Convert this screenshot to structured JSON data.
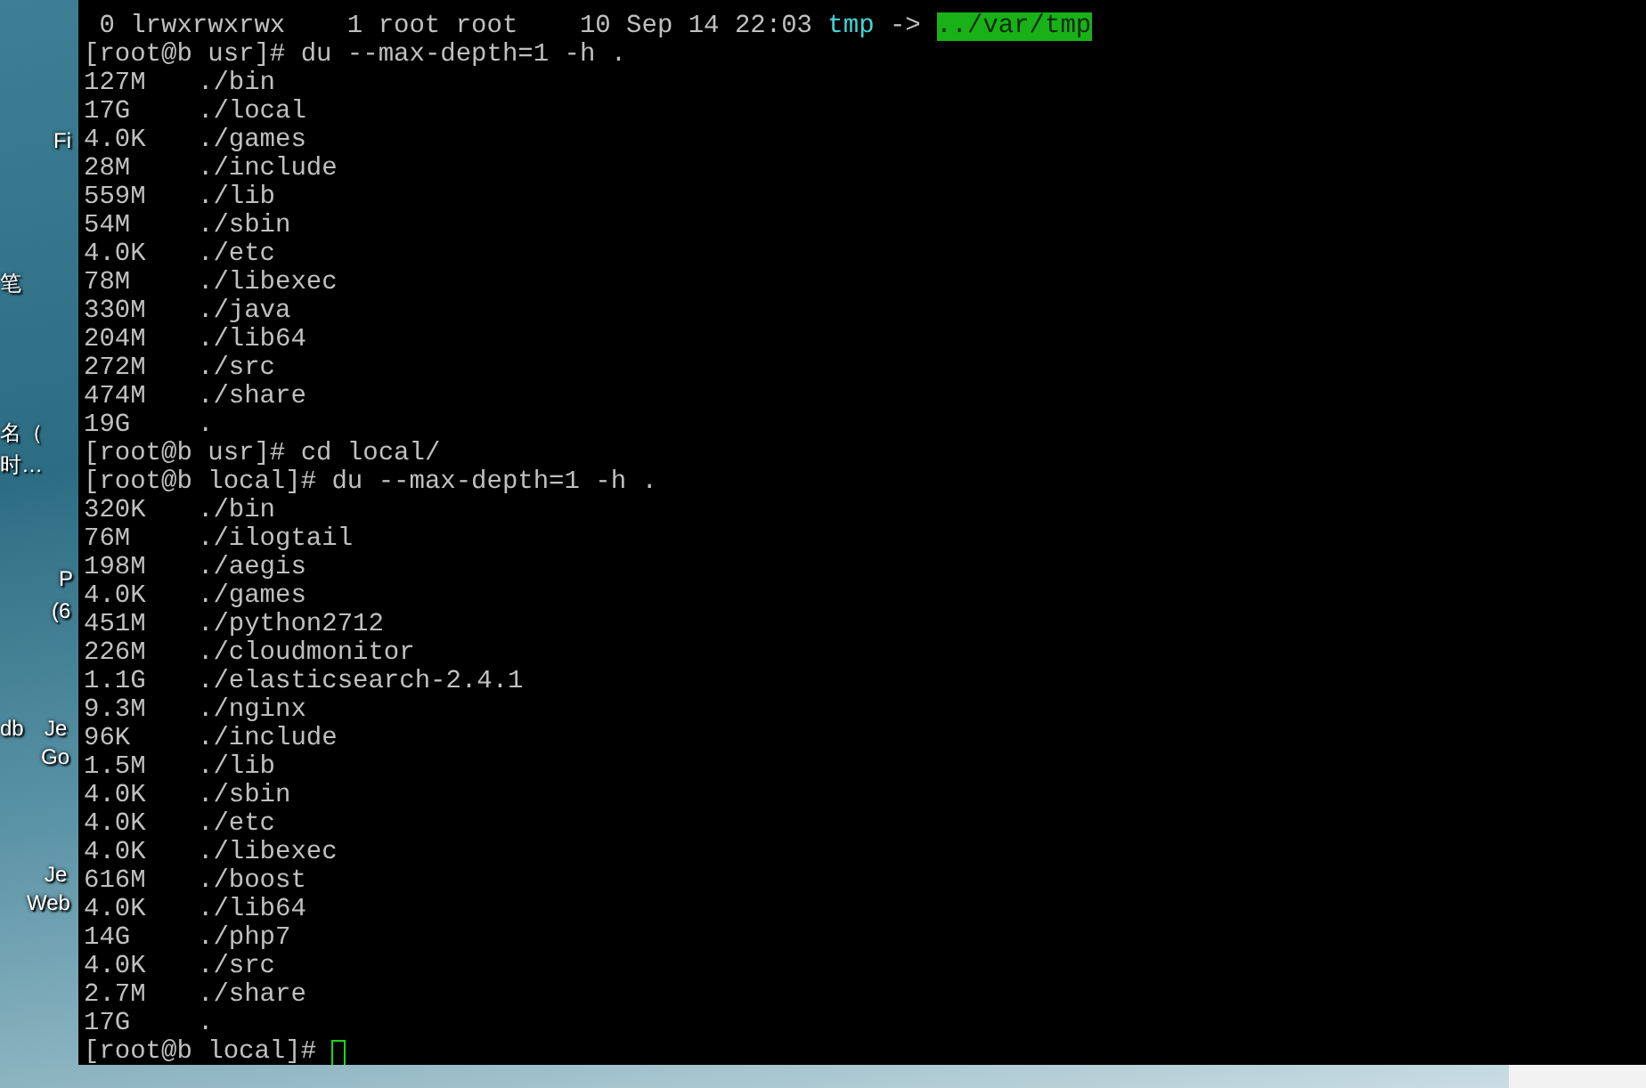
{
  "desktop": {
    "labels": [
      {
        "text": "Fi"
      },
      {
        "text": "笔"
      },
      {
        "text": "名（"
      },
      {
        "text": "时…"
      },
      {
        "text": "P"
      },
      {
        "text": "(6"
      },
      {
        "text": "db"
      },
      {
        "text": "Je"
      },
      {
        "text": "Go"
      },
      {
        "text": "Je"
      },
      {
        "text": "Web"
      }
    ]
  },
  "terminal": {
    "lines": [
      {
        "kind": "listing",
        "text": " 0 lrwxrwxrwx    1 root root    10 Sep 14 22:03 ",
        "name": "tmp",
        "color": "#3fd7d7",
        "arrow": " -> ",
        "target": "../var/tmp"
      },
      {
        "kind": "prompt",
        "prompt": "[root@b usr]#",
        "command": "du --max-depth=1 -h ."
      },
      {
        "kind": "du",
        "size": "127M",
        "path": "./bin"
      },
      {
        "kind": "du",
        "size": "17G",
        "path": "./local"
      },
      {
        "kind": "du",
        "size": "4.0K",
        "path": "./games"
      },
      {
        "kind": "du",
        "size": "28M",
        "path": "./include"
      },
      {
        "kind": "du",
        "size": "559M",
        "path": "./lib"
      },
      {
        "kind": "du",
        "size": "54M",
        "path": "./sbin"
      },
      {
        "kind": "du",
        "size": "4.0K",
        "path": "./etc"
      },
      {
        "kind": "du",
        "size": "78M",
        "path": "./libexec"
      },
      {
        "kind": "du",
        "size": "330M",
        "path": "./java"
      },
      {
        "kind": "du",
        "size": "204M",
        "path": "./lib64"
      },
      {
        "kind": "du",
        "size": "272M",
        "path": "./src"
      },
      {
        "kind": "du",
        "size": "474M",
        "path": "./share"
      },
      {
        "kind": "du",
        "size": "19G",
        "path": "."
      },
      {
        "kind": "prompt",
        "prompt": "[root@b usr]#",
        "command": "cd local/"
      },
      {
        "kind": "prompt",
        "prompt": "[root@b local]#",
        "command": "du --max-depth=1 -h ."
      },
      {
        "kind": "du",
        "size": "320K",
        "path": "./bin"
      },
      {
        "kind": "du",
        "size": "76M",
        "path": "./ilogtail"
      },
      {
        "kind": "du",
        "size": "198M",
        "path": "./aegis"
      },
      {
        "kind": "du",
        "size": "4.0K",
        "path": "./games"
      },
      {
        "kind": "du",
        "size": "451M",
        "path": "./python2712"
      },
      {
        "kind": "du",
        "size": "226M",
        "path": "./cloudmonitor"
      },
      {
        "kind": "du",
        "size": "1.1G",
        "path": "./elasticsearch-2.4.1"
      },
      {
        "kind": "du",
        "size": "9.3M",
        "path": "./nginx"
      },
      {
        "kind": "du",
        "size": "96K",
        "path": "./include"
      },
      {
        "kind": "du",
        "size": "1.5M",
        "path": "./lib"
      },
      {
        "kind": "du",
        "size": "4.0K",
        "path": "./sbin"
      },
      {
        "kind": "du",
        "size": "4.0K",
        "path": "./etc"
      },
      {
        "kind": "du",
        "size": "4.0K",
        "path": "./libexec"
      },
      {
        "kind": "du",
        "size": "616M",
        "path": "./boost"
      },
      {
        "kind": "du",
        "size": "4.0K",
        "path": "./lib64"
      },
      {
        "kind": "du",
        "size": "14G",
        "path": "./php7"
      },
      {
        "kind": "du",
        "size": "4.0K",
        "path": "./src"
      },
      {
        "kind": "du",
        "size": "2.7M",
        "path": "./share"
      },
      {
        "kind": "du",
        "size": "17G",
        "path": "."
      },
      {
        "kind": "prompt",
        "prompt": "[root@b local]#",
        "cursor": true
      }
    ]
  }
}
